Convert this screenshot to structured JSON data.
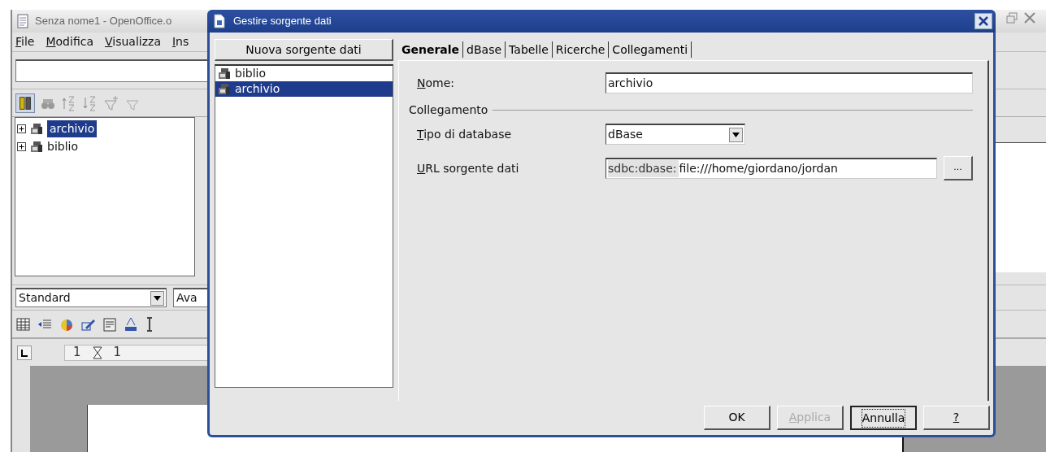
{
  "app": {
    "title": "Senza nome1 - OpenOffice.o",
    "menu": [
      {
        "label": "File",
        "mnemonic": true
      },
      {
        "label": "Modifica",
        "mnemonic": true
      },
      {
        "label": "Visualizza",
        "mnemonic": true
      },
      {
        "label": "Ins",
        "mnemonic": true
      }
    ],
    "tree": [
      {
        "label": "archivio",
        "selected": true,
        "expanded": false
      },
      {
        "label": "biblio",
        "selected": false,
        "expanded": false
      }
    ],
    "style_box": {
      "value": "Standard"
    },
    "font_box": {
      "value": "Ava"
    },
    "ruler": [
      "1",
      "1"
    ]
  },
  "dialog": {
    "title": "Gestire sorgente dati",
    "new_button": "Nuova sorgente dati",
    "sources": [
      {
        "label": "biblio",
        "selected": false
      },
      {
        "label": "archivio",
        "selected": true
      }
    ],
    "tabs": [
      {
        "label": "Generale",
        "selected": true
      },
      {
        "label": "dBase",
        "selected": false
      },
      {
        "label": "Tabelle",
        "selected": false
      },
      {
        "label": "Ricerche",
        "selected": false
      },
      {
        "label": "Collegamenti",
        "selected": false
      }
    ],
    "name": {
      "label": "Nome:",
      "mnemonic": true,
      "value": "archivio"
    },
    "section": "Collegamento",
    "db_type": {
      "label": "Tipo di database",
      "mnemonic": true,
      "value": "dBase"
    },
    "url": {
      "label": "URL sorgente dati",
      "mnemonic": true,
      "prefix": "sdbc:dbase:",
      "value": "file:///home/giordano/jordan"
    },
    "browse_button": "...",
    "buttons": [
      {
        "label": "OK",
        "disabled": false,
        "focused": false,
        "mnemonic": false
      },
      {
        "label": "Applica",
        "disabled": true,
        "focused": false,
        "mnemonic": true
      },
      {
        "label": "Annulla",
        "disabled": false,
        "focused": true,
        "mnemonic": false
      },
      {
        "label": "?",
        "disabled": false,
        "focused": false,
        "mnemonic": true
      }
    ]
  }
}
